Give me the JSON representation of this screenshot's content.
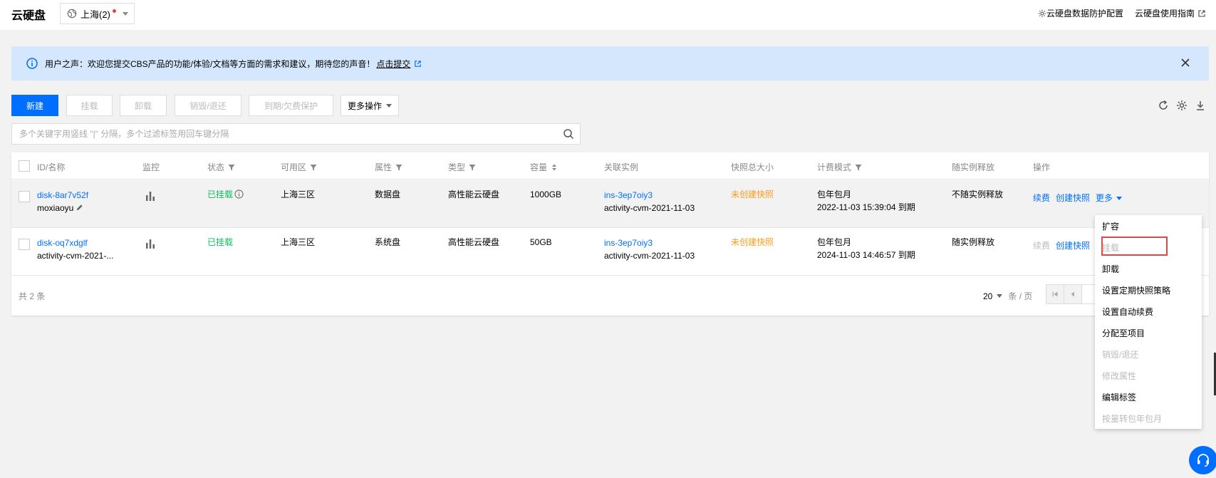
{
  "header": {
    "title": "云硬盘",
    "region": "上海(2)",
    "links": [
      "云硬盘数据防护配置",
      "云硬盘使用指南"
    ]
  },
  "notice": {
    "text": "用户之声：欢迎您提交CBS产品的功能/体验/文档等方面的需求和建议，期待您的声音！",
    "link": "点击提交"
  },
  "toolbar": {
    "new": "新建",
    "attach": "挂载",
    "detach": "卸载",
    "destroy": "销毁/退还",
    "expire_protect": "到期/欠费保护",
    "more": "更多操作"
  },
  "search": {
    "placeholder": "多个关键字用竖线 \"|\" 分隔，多个过滤标签用回车键分隔"
  },
  "table": {
    "columns": [
      "ID/名称",
      "监控",
      "状态",
      "可用区",
      "属性",
      "类型",
      "容量",
      "关联实例",
      "快照总大小",
      "计费模式",
      "随实例释放",
      "操作"
    ],
    "rows": [
      {
        "id": "disk-8ar7v52f",
        "name": "moxiaoyu",
        "status": "已挂载",
        "zone": "上海三区",
        "attr": "数据盘",
        "type": "高性能云硬盘",
        "capacity": "1000GB",
        "instance_id": "ins-3ep7oiy3",
        "instance_name": "activity-cvm-2021-11-03",
        "snapshot": "未创建快照",
        "billing": "包年包月",
        "expire": "2022-11-03 15:39:04 到期",
        "release": "不随实例释放",
        "actions": [
          "续费",
          "创建快照",
          "更多"
        ]
      },
      {
        "id": "disk-oq7xdglf",
        "name": "activity-cvm-2021-...",
        "status": "已挂载",
        "zone": "上海三区",
        "attr": "系统盘",
        "type": "高性能云硬盘",
        "capacity": "50GB",
        "instance_id": "ins-3ep7oiy3",
        "instance_name": "activity-cvm-2021-11-03",
        "snapshot": "未创建快照",
        "billing": "包年包月",
        "expire": "2024-11-03 14:46:57 到期",
        "release": "随实例释放",
        "actions": [
          "续费",
          "创建快照"
        ]
      }
    ],
    "total": "共 2 条",
    "page_size": "20",
    "page_unit": "条 / 页"
  },
  "dropdown": {
    "items": [
      {
        "label": "扩容",
        "enabled": true
      },
      {
        "label": "挂载",
        "enabled": false
      },
      {
        "label": "卸载",
        "enabled": true
      },
      {
        "label": "设置定期快照策略",
        "enabled": true
      },
      {
        "label": "设置自动续费",
        "enabled": true
      },
      {
        "label": "分配至项目",
        "enabled": true
      },
      {
        "label": "销毁/退还",
        "enabled": false
      },
      {
        "label": "修改属性",
        "enabled": false
      },
      {
        "label": "编辑标签",
        "enabled": true
      },
      {
        "label": "按量转包年包月",
        "enabled": false
      }
    ]
  },
  "colors": {
    "primary": "#006eff",
    "success": "#0abf5b",
    "warning": "#ff9c19",
    "highlight": "#e54545"
  }
}
